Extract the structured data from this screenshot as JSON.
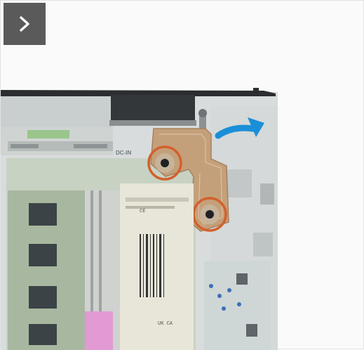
{
  "navigation": {
    "next_icon": "chevron-right-icon"
  },
  "illustration": {
    "board_label": "DC-IN",
    "ram_label_ce": "CE",
    "ram_label_uk": "UK CA",
    "step_action": "rotate-hinge-upward",
    "screw_highlight_color": "#d2612c",
    "arrow_color": "#1a8fd8",
    "hinge_color": "#b58f6a"
  }
}
